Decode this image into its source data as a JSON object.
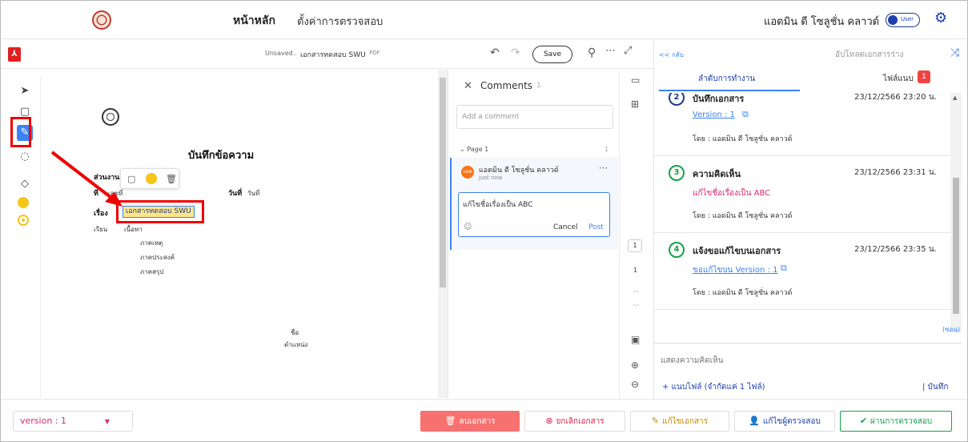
{
  "topnav": {
    "home_label": "หน้าหลัก",
    "settings_label": "ตั้งค่าการตรวจสอบ",
    "username": "แอดมิน ดี โซลูชั่น คลาวด์",
    "toggle_label": "User"
  },
  "pdfbar": {
    "status": "Unsaved..",
    "title": "เอกสารทดสอบ SWU",
    "type": "PDF",
    "save_label": "Save"
  },
  "document": {
    "title": "บันทึกข้อความ",
    "field_section": "ส่วนงาน",
    "field_no": "ที่",
    "field_no_value": "เลขที่",
    "field_date": "วันที่",
    "field_date_value": "วันที่",
    "field_subject": "เรื่อง",
    "subject_value": "เอกสารทดสอบ SWU",
    "field_to": "เรียน",
    "field_to_value": "เนื้อหา",
    "line1": "ภาคเหตุ",
    "line2": "ภาคประสงค์",
    "line3": "ภาคสรุป",
    "sign_name": "ชื่อ",
    "sign_position": "ตำแหน่ง"
  },
  "comments": {
    "title": "Comments",
    "count": "1",
    "add_placeholder": "Add a comment",
    "page_label": "Page 1",
    "page_count": "1",
    "author_initials": "แอด",
    "author": "แอดมิน ดี โซลูชั่น คลาวด์",
    "time": "just now",
    "reply_text": "แก้ไขชื่อเรื่องเป็น ABC",
    "cancel_label": "Cancel",
    "post_label": "Post"
  },
  "vstrip": {
    "page_box": "1",
    "page_num": "1"
  },
  "rpanel": {
    "back_label": "<< กลับ",
    "upload_label": "อัปโหลดเอกสารร่าง",
    "tab_order": "ลำดับการทำงาน",
    "tab_files": "ไฟล์แนบ",
    "tab_files_badge": "1",
    "steps": [
      {
        "num": "2",
        "title": "บันทึกเอกสาร",
        "date": "23/12/2566 23:20 น.",
        "link": "Version : 1",
        "by": "โดย : แอดมิน ดี โซลูชั่น คลาวด์"
      },
      {
        "num": "3",
        "title": "ความคิดเห็น",
        "date": "23/12/2566 23:31 น.",
        "note": "แก้ไขชื่อเรื่องเป็น ABC",
        "by": "โดย : แอดมิน ดี โซลูชั่น คลาวด์"
      },
      {
        "num": "4",
        "title": "แจ้งขอแก้ไขบนเอกสาร",
        "date": "23/12/2566 23:35 น.",
        "link": "ขอแก้ไขบน Version : 1",
        "by": "โดย : แอดมิน ดี โซลูชั่น คลาวด์"
      }
    ],
    "hide_label": "(ซ่อน)",
    "comment_placeholder": "แสดงความคิดเห็น",
    "attach_label": "+ แนบไฟล์ (จำกัดแค่ 1 ไฟล์)",
    "save_label": "| บันทึก"
  },
  "bottombar": {
    "version_label": "version : 1",
    "delete_label": "ลบเอกสาร",
    "cancel_label": "ยกเลิกเอกสาร",
    "edit_label": "แก้ไขเอกสาร",
    "reviewer_label": "แก้ไขผู้ตรวจสอบ",
    "approve_label": "ผ่านการตรวจสอบ"
  },
  "colors": {
    "accent": "#1e40af",
    "highlight": "#fde68a",
    "annotation_red": "#e00000",
    "approve": "#16a34a",
    "delete": "#f87171"
  }
}
